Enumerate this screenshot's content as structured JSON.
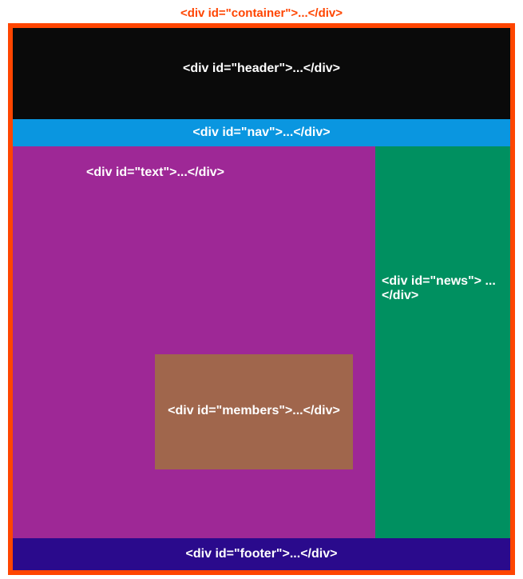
{
  "container_label": "<div id=\"container\">...</div>",
  "header": {
    "label": "<div id=\"header\">...</div>"
  },
  "nav": {
    "label": "<div id=\"nav\">...</div>"
  },
  "text": {
    "label": "<div id=\"text\">...</div>"
  },
  "news": {
    "label": "<div id=\"news\"> ...</div>"
  },
  "members": {
    "label": "<div id=\"members\">...</div>"
  },
  "footer": {
    "label": "<div id=\"footer\">...</div>"
  },
  "colors": {
    "container_border": "#ff4500",
    "header_bg": "#0a0a0a",
    "nav_bg": "#0a96e0",
    "text_bg": "#9e2896",
    "news_bg": "#009060",
    "members_bg": "#a0664c",
    "footer_bg": "#2a0a8c"
  }
}
